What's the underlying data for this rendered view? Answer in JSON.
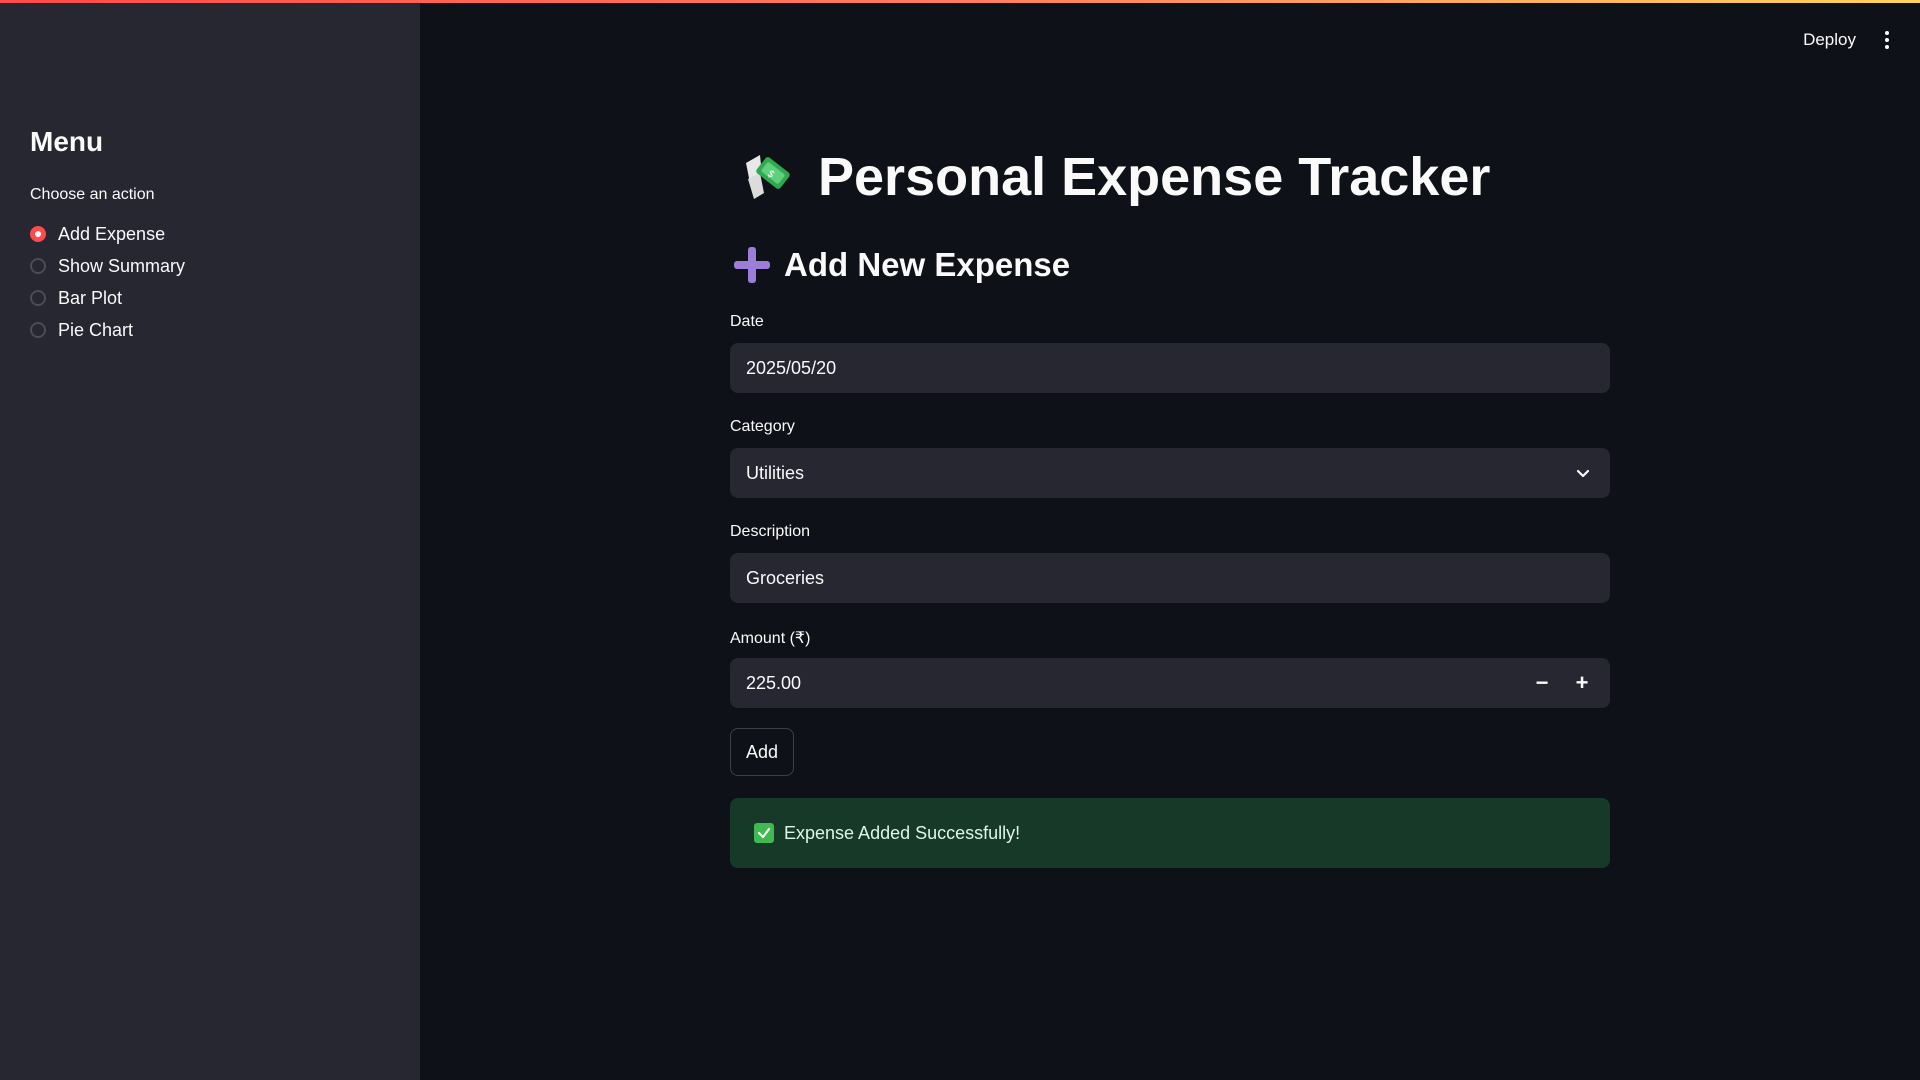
{
  "sidebar": {
    "title": "Menu",
    "radio_label": "Choose an action",
    "options": [
      {
        "label": "Add Expense",
        "selected": true
      },
      {
        "label": "Show Summary",
        "selected": false
      },
      {
        "label": "Bar Plot",
        "selected": false
      },
      {
        "label": "Pie Chart",
        "selected": false
      }
    ]
  },
  "header": {
    "deploy_label": "Deploy"
  },
  "main": {
    "title_icon": "money-with-wings-icon",
    "title": "Personal Expense Tracker",
    "section_icon": "plus-icon",
    "section_title": "Add New Expense",
    "date": {
      "label": "Date",
      "value": "2025/05/20"
    },
    "category": {
      "label": "Category",
      "value": "Utilities"
    },
    "description": {
      "label": "Description",
      "value": "Groceries"
    },
    "amount": {
      "label": "Amount (₹)",
      "value": "225.00",
      "decrement": "−",
      "increment": "+"
    },
    "add_button": "Add",
    "success_message": "Expense Added Successfully!"
  },
  "colors": {
    "accent": "#ff4b4b",
    "background": "#0e1117",
    "sidebar": "#262730",
    "success_bg": "#173928"
  }
}
